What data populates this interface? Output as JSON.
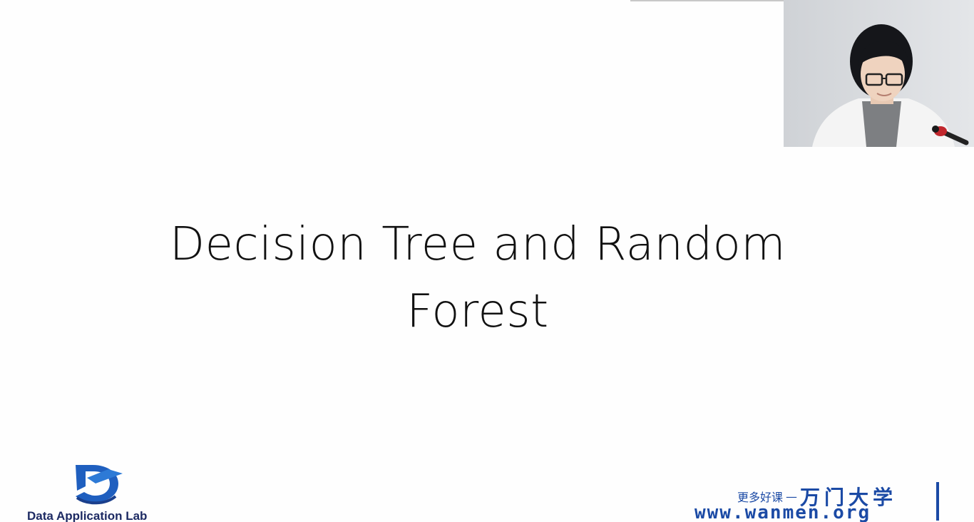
{
  "slide": {
    "title_line1": "Decision Tree and Random",
    "title_line2": "Forest"
  },
  "logos": {
    "lab_name": "Data Application Lab",
    "lab_color": "#1d2a63",
    "wanmen_slogan": "更多好课",
    "wanmen_dash": "—",
    "wanmen_brand": "万门大学",
    "wanmen_url": "www.wanmen.org",
    "wanmen_color": "#1b4aa5"
  },
  "webcam": {
    "icon": "presenter-webcam"
  }
}
